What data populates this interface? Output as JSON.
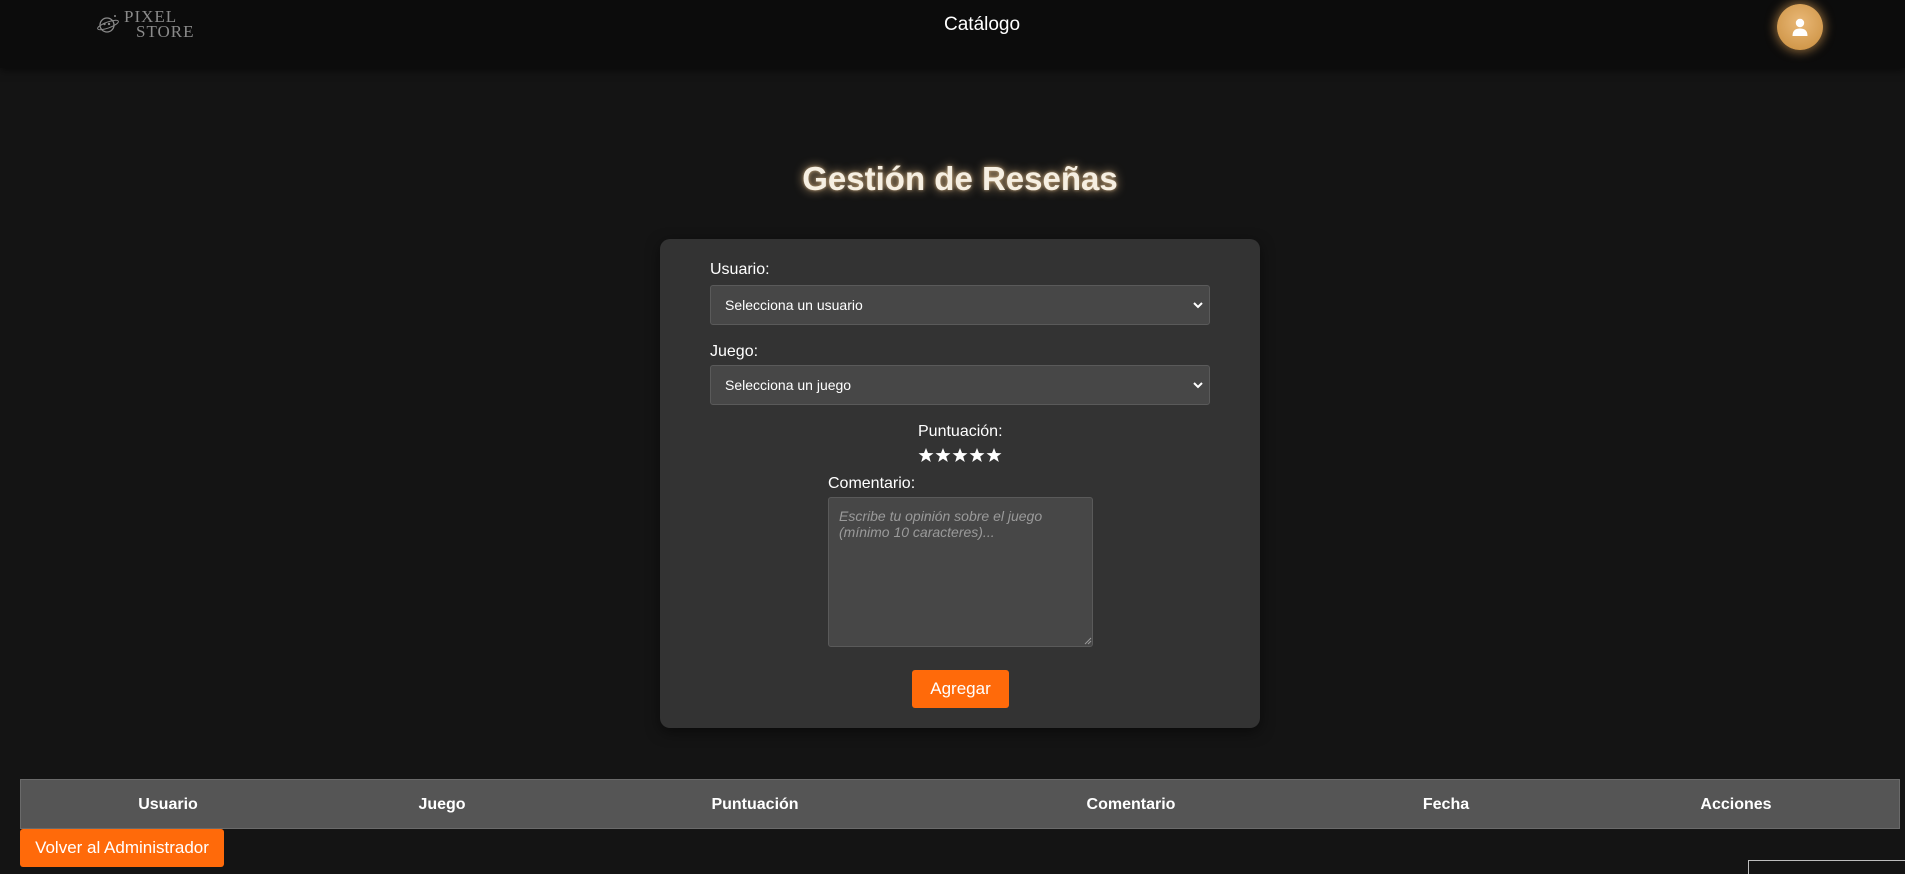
{
  "header": {
    "logo": {
      "line1": "PIXEL",
      "line2": "STORE",
      "icon": "planet-logo-icon"
    },
    "nav_link": "Catálogo",
    "avatar_icon": "user-icon"
  },
  "page_title": "Gestión de Reseñas",
  "form": {
    "user_label": "Usuario:",
    "user_select_value": "Selecciona un usuario",
    "game_label": "Juego:",
    "game_select_value": "Selecciona un juego",
    "rating_label": "Puntuación:",
    "rating_stars_total": 5,
    "comment_label": "Comentario:",
    "comment_placeholder": "Escribe tu opinión sobre el juego (mínimo 10 caracteres)...",
    "submit_label": "Agregar"
  },
  "table": {
    "columns": [
      "Usuario",
      "Juego",
      "Puntuación",
      "Comentario",
      "Fecha",
      "Acciones"
    ]
  },
  "back_button_label": "Volver al Administrador",
  "colors": {
    "background": "#141414",
    "topbar": "#0c0c0c",
    "card": "#333333",
    "accent": "#ff6a0a",
    "avatar": "#d9a15a",
    "table_header": "#555555"
  }
}
